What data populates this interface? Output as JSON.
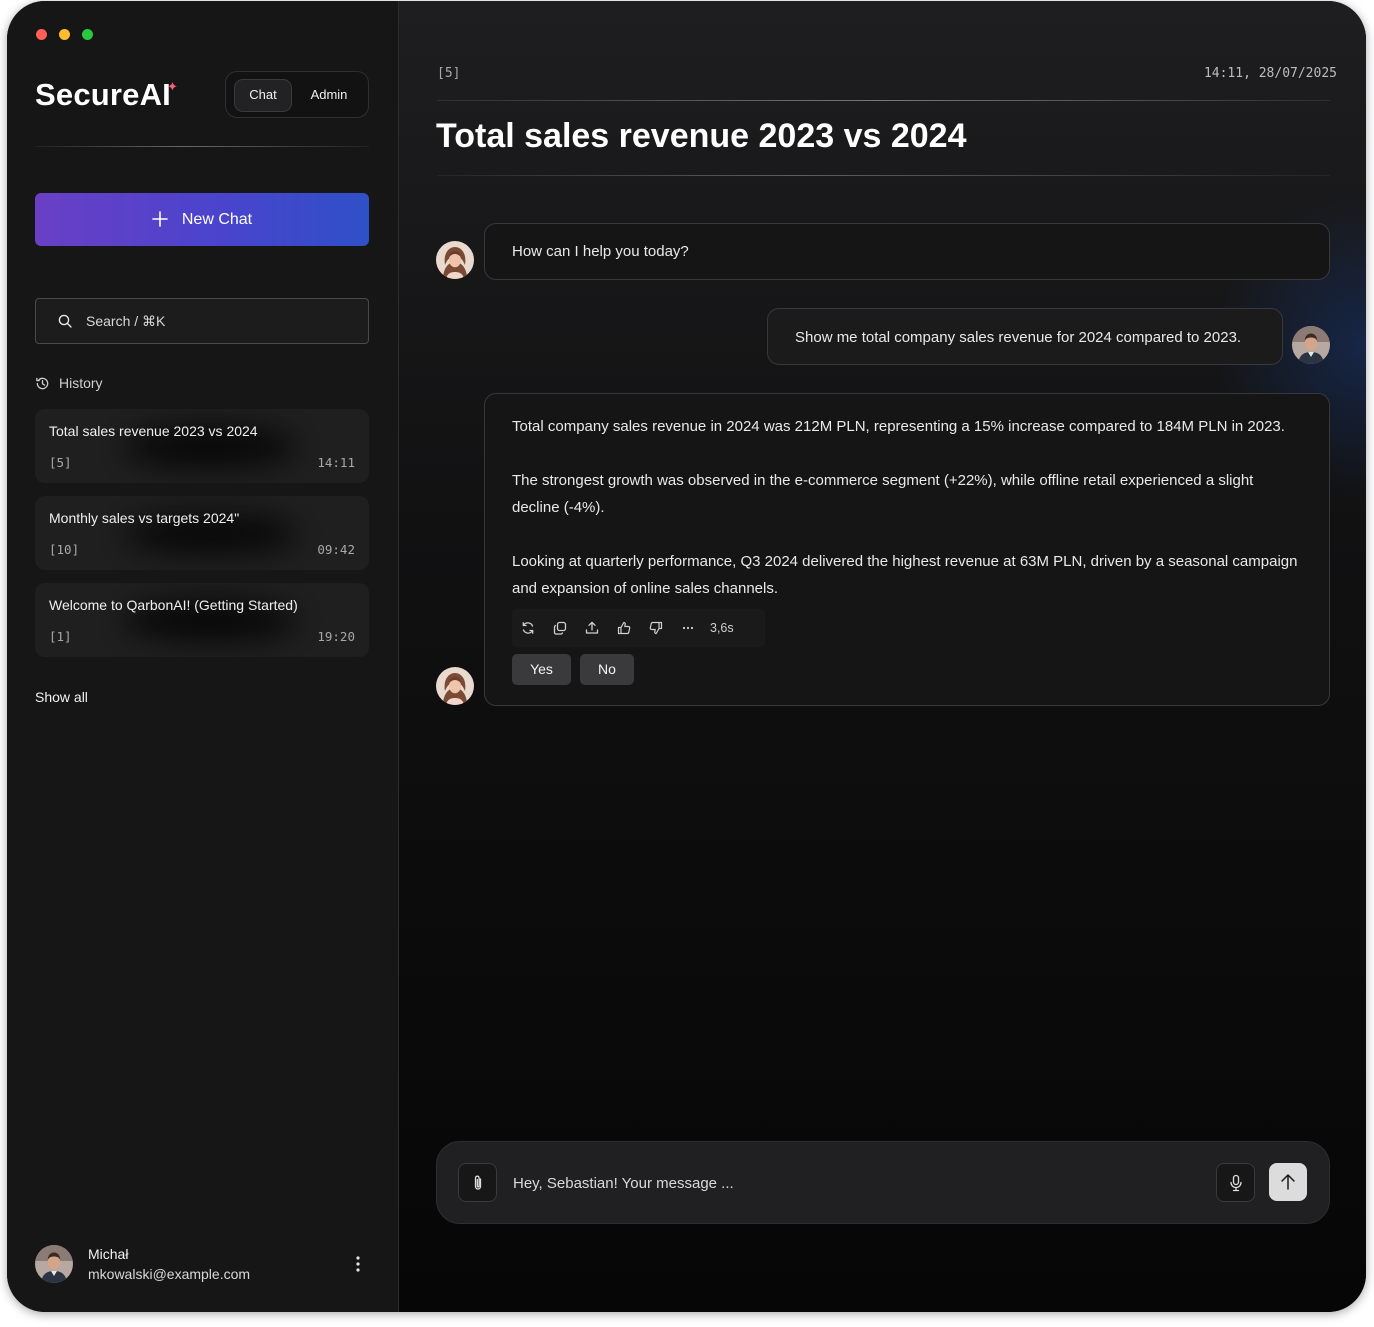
{
  "window_controls": {
    "close_color": "#ff5f57",
    "minimize_color": "#febc2e",
    "maximize_color": "#28c840"
  },
  "app": {
    "logo_text": "SecureAI",
    "accent_color": "#ff5f7a"
  },
  "mode_switch": {
    "chat_label": "Chat",
    "admin_label": "Admin",
    "active": "Chat"
  },
  "sidebar": {
    "new_chat_label": "New Chat",
    "search_placeholder": "Search / ⌘K",
    "history_label": "History",
    "history": [
      {
        "title": "Total sales revenue 2023 vs 2024",
        "count": "[5]",
        "time": "14:11"
      },
      {
        "title": "Monthly sales vs targets 2024\"",
        "count": "[10]",
        "time": "09:42"
      },
      {
        "title": "Welcome to QarbonAI! (Getting Started)",
        "count": "[1]",
        "time": "19:20"
      }
    ],
    "show_all_label": "Show all",
    "user": {
      "name": "Michał",
      "email": "mkowalski@example.com"
    }
  },
  "chat": {
    "message_count": "[5]",
    "timestamp": "14:11, 28/07/2025",
    "title": "Total sales revenue 2023 vs 2024",
    "messages": [
      {
        "role": "assistant",
        "text": "How can I help you today?"
      },
      {
        "role": "user",
        "text": "Show me total company sales revenue for 2024 compared to 2023."
      },
      {
        "role": "assistant",
        "paragraphs": [
          "Total company sales revenue in 2024 was 212M PLN, representing a 15% increase compared to 184M PLN in 2023.",
          "The strongest growth was observed in the e-commerce segment (+22%), while offline retail experienced a slight decline (-4%).",
          "Looking at quarterly performance, Q3 2024 delivered the highest revenue at 63M PLN, driven by a seasonal campaign and expansion of online sales channels."
        ],
        "response_time": "3,6s",
        "actions": [
          "regenerate-icon",
          "copy-icon",
          "share-icon",
          "thumbs-up-icon",
          "thumbs-down-icon",
          "more-icon"
        ],
        "yes_label": "Yes",
        "no_label": "No"
      }
    ]
  },
  "composer": {
    "placeholder": "Hey, Sebastian! Your message ..."
  },
  "colors": {
    "new_chat_gradient_start": "#6a3fc6",
    "new_chat_gradient_end": "#2f50c8",
    "background": "#0c0c0d"
  }
}
